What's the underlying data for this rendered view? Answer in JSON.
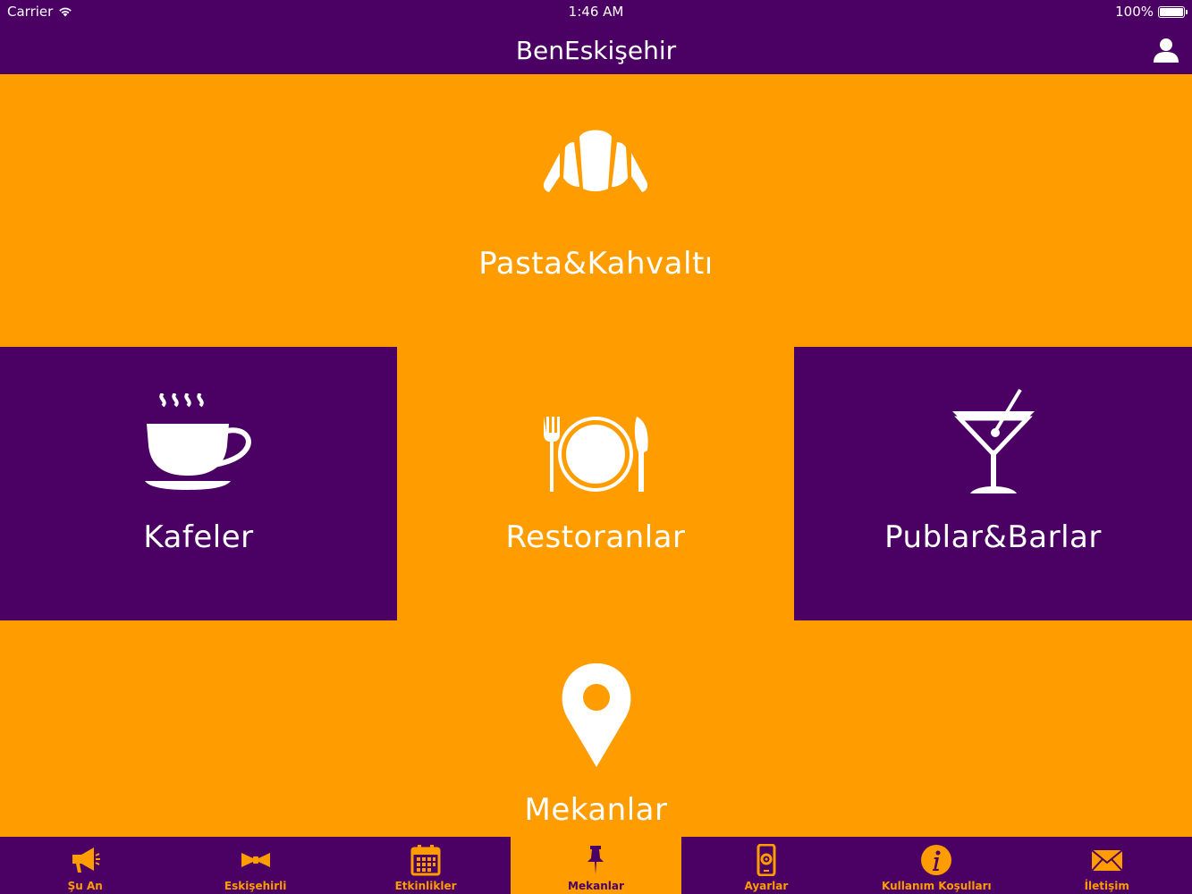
{
  "status_bar": {
    "carrier": "Carrier",
    "time": "1:46 AM",
    "battery": "100%"
  },
  "nav": {
    "title": "BenEskişehir",
    "profile_icon": "user-icon"
  },
  "colors": {
    "purple": "#4b0064",
    "orange": "#ff9c00",
    "white": "#ffffff"
  },
  "tiles": [
    {
      "label": "Pasta&Kahvaltı",
      "icon": "croissant-icon"
    },
    {
      "label": "Kafeler",
      "icon": "coffee-cup-icon"
    },
    {
      "label": "Restoranlar",
      "icon": "plate-cutlery-icon"
    },
    {
      "label": "Publar&Barlar",
      "icon": "cocktail-icon"
    },
    {
      "label": "Mekanlar",
      "icon": "map-pin-icon"
    }
  ],
  "tabs": [
    {
      "label": "Şu An",
      "icon": "megaphone-icon",
      "active": false
    },
    {
      "label": "Eskişehirli",
      "icon": "bowtie-icon",
      "active": false
    },
    {
      "label": "Etkinlikler",
      "icon": "calendar-icon",
      "active": false
    },
    {
      "label": "Mekanlar",
      "icon": "pin-icon",
      "active": true
    },
    {
      "label": "Ayarlar",
      "icon": "phone-settings-icon",
      "active": false
    },
    {
      "label": "Kullanım Koşulları",
      "icon": "info-icon",
      "active": false
    },
    {
      "label": "İletişim",
      "icon": "envelope-icon",
      "active": false
    }
  ]
}
